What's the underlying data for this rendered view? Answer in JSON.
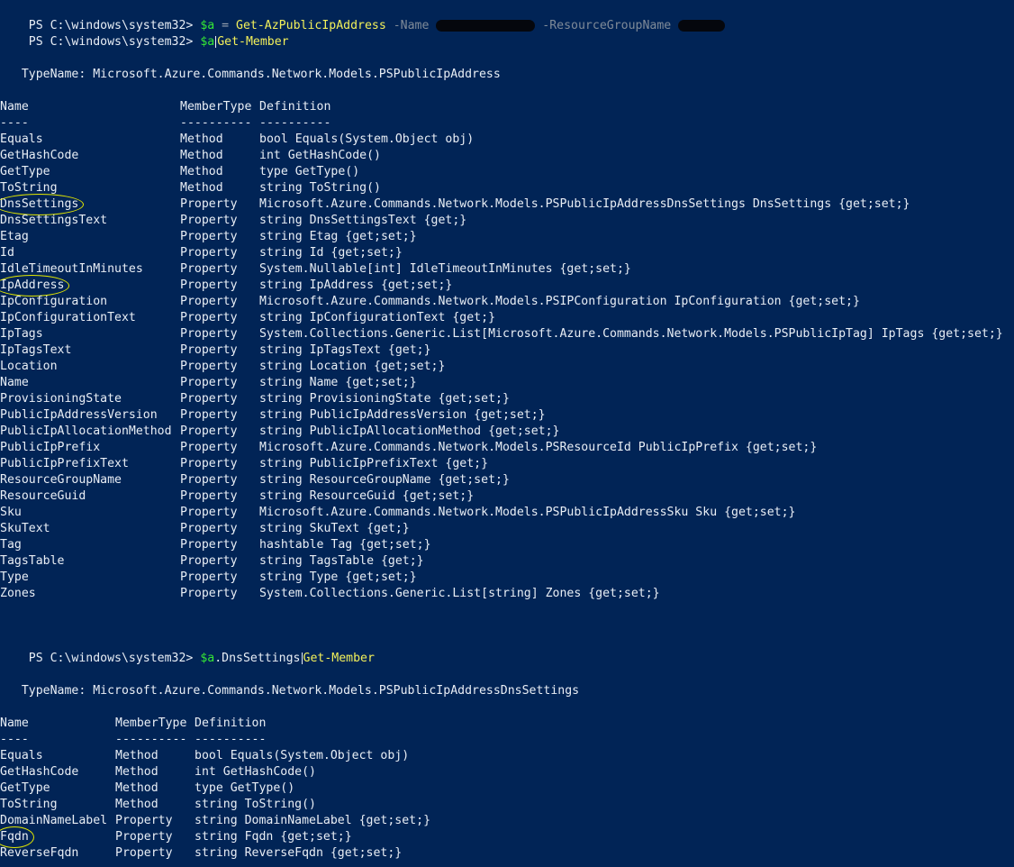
{
  "cmd1": {
    "prompt": "PS C:\\windows\\system32> ",
    "var": "$a",
    "assign": " = ",
    "cmdlet": "Get-AzPublicIpAddress",
    "param1": " -Name ",
    "param2": " -ResourceGroupName "
  },
  "cmd2": {
    "prompt": "PS C:\\windows\\system32> ",
    "var": "$a",
    "cmdlet": "Get-Member"
  },
  "block1": {
    "typename": "   TypeName: Microsoft.Azure.Commands.Network.Models.PSPublicIpAddress",
    "headers": [
      "Name",
      "MemberType",
      "Definition"
    ],
    "underlines": [
      "----",
      "----------",
      "----------"
    ],
    "rows": [
      [
        "Equals",
        "Method",
        "bool Equals(System.Object obj)"
      ],
      [
        "GetHashCode",
        "Method",
        "int GetHashCode()"
      ],
      [
        "GetType",
        "Method",
        "type GetType()"
      ],
      [
        "ToString",
        "Method",
        "string ToString()"
      ],
      [
        "DnsSettings",
        "Property",
        "Microsoft.Azure.Commands.Network.Models.PSPublicIpAddressDnsSettings DnsSettings {get;set;}"
      ],
      [
        "DnsSettingsText",
        "Property",
        "string DnsSettingsText {get;}"
      ],
      [
        "Etag",
        "Property",
        "string Etag {get;set;}"
      ],
      [
        "Id",
        "Property",
        "string Id {get;set;}"
      ],
      [
        "IdleTimeoutInMinutes",
        "Property",
        "System.Nullable[int] IdleTimeoutInMinutes {get;set;}"
      ],
      [
        "IpAddress",
        "Property",
        "string IpAddress {get;set;}"
      ],
      [
        "IpConfiguration",
        "Property",
        "Microsoft.Azure.Commands.Network.Models.PSIPConfiguration IpConfiguration {get;set;}"
      ],
      [
        "IpConfigurationText",
        "Property",
        "string IpConfigurationText {get;}"
      ],
      [
        "IpTags",
        "Property",
        "System.Collections.Generic.List[Microsoft.Azure.Commands.Network.Models.PSPublicIpTag] IpTags {get;set;}"
      ],
      [
        "IpTagsText",
        "Property",
        "string IpTagsText {get;}"
      ],
      [
        "Location",
        "Property",
        "string Location {get;set;}"
      ],
      [
        "Name",
        "Property",
        "string Name {get;set;}"
      ],
      [
        "ProvisioningState",
        "Property",
        "string ProvisioningState {get;set;}"
      ],
      [
        "PublicIpAddressVersion",
        "Property",
        "string PublicIpAddressVersion {get;set;}"
      ],
      [
        "PublicIpAllocationMethod",
        "Property",
        "string PublicIpAllocationMethod {get;set;}"
      ],
      [
        "PublicIpPrefix",
        "Property",
        "Microsoft.Azure.Commands.Network.Models.PSResourceId PublicIpPrefix {get;set;}"
      ],
      [
        "PublicIpPrefixText",
        "Property",
        "string PublicIpPrefixText {get;}"
      ],
      [
        "ResourceGroupName",
        "Property",
        "string ResourceGroupName {get;set;}"
      ],
      [
        "ResourceGuid",
        "Property",
        "string ResourceGuid {get;set;}"
      ],
      [
        "Sku",
        "Property",
        "Microsoft.Azure.Commands.Network.Models.PSPublicIpAddressSku Sku {get;set;}"
      ],
      [
        "SkuText",
        "Property",
        "string SkuText {get;}"
      ],
      [
        "Tag",
        "Property",
        "hashtable Tag {get;set;}"
      ],
      [
        "TagsTable",
        "Property",
        "string TagsTable {get;}"
      ],
      [
        "Type",
        "Property",
        "string Type {get;set;}"
      ],
      [
        "Zones",
        "Property",
        "System.Collections.Generic.List[string] Zones {get;set;}"
      ]
    ]
  },
  "cmd3": {
    "prompt": "PS C:\\windows\\system32> ",
    "var": "$a",
    "prop": ".DnsSettings",
    "cmdlet": "Get-Member"
  },
  "block2": {
    "typename": "   TypeName: Microsoft.Azure.Commands.Network.Models.PSPublicIpAddressDnsSettings",
    "headers": [
      "Name",
      "MemberType",
      "Definition"
    ],
    "underlines": [
      "----",
      "----------",
      "----------"
    ],
    "rows": [
      [
        "Equals",
        "Method",
        "bool Equals(System.Object obj)"
      ],
      [
        "GetHashCode",
        "Method",
        "int GetHashCode()"
      ],
      [
        "GetType",
        "Method",
        "type GetType()"
      ],
      [
        "ToString",
        "Method",
        "string ToString()"
      ],
      [
        "DomainNameLabel",
        "Property",
        "string DomainNameLabel {get;set;}"
      ],
      [
        "Fqdn",
        "Property",
        "string Fqdn {get;set;}"
      ],
      [
        "ReverseFqdn",
        "Property",
        "string ReverseFqdn {get;set;}"
      ]
    ]
  },
  "colors": {
    "background": "#012456",
    "text": "#e9eef5",
    "variable": "#35e635",
    "cmdlet": "#f3f05a",
    "parameter": "#7f8a98",
    "highlight_circle": "#e4e800"
  }
}
